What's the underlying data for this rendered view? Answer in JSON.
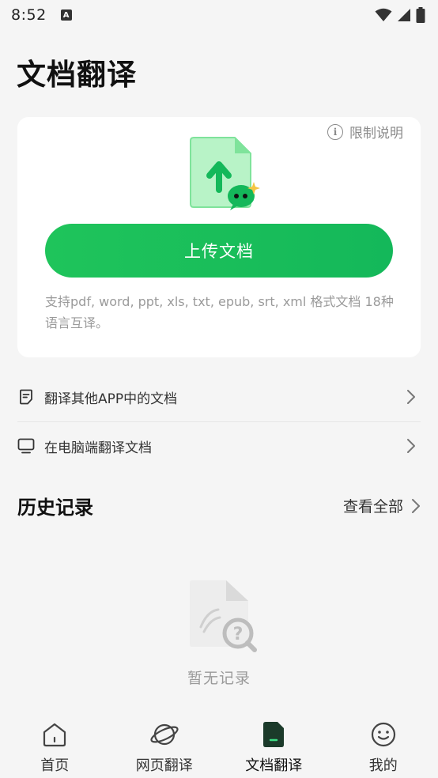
{
  "status_bar": {
    "time": "8:52",
    "notification_glyph": "A"
  },
  "page_title": "文档翻译",
  "upload_card": {
    "limit_link": "限制说明",
    "upload_button": "上传文档",
    "support_text": "支持pdf, word, ppt, xls, txt, epub, srt, xml 格式文档 18种语言互译。"
  },
  "options": [
    {
      "label": "翻译其他APP中的文档",
      "icon": "document-icon"
    },
    {
      "label": "在电脑端翻译文档",
      "icon": "monitor-icon"
    }
  ],
  "history": {
    "title": "历史记录",
    "view_all": "查看全部",
    "empty_text": "暂无记录"
  },
  "bottom_nav": [
    {
      "label": "首页",
      "icon": "home-icon",
      "active": false
    },
    {
      "label": "网页翻译",
      "icon": "planet-icon",
      "active": false
    },
    {
      "label": "文档翻译",
      "icon": "document-filled-icon",
      "active": true
    },
    {
      "label": "我的",
      "icon": "smiley-icon",
      "active": false
    }
  ],
  "colors": {
    "accent": "#1fc45b",
    "background": "#f5f5f5",
    "card": "#ffffff"
  }
}
